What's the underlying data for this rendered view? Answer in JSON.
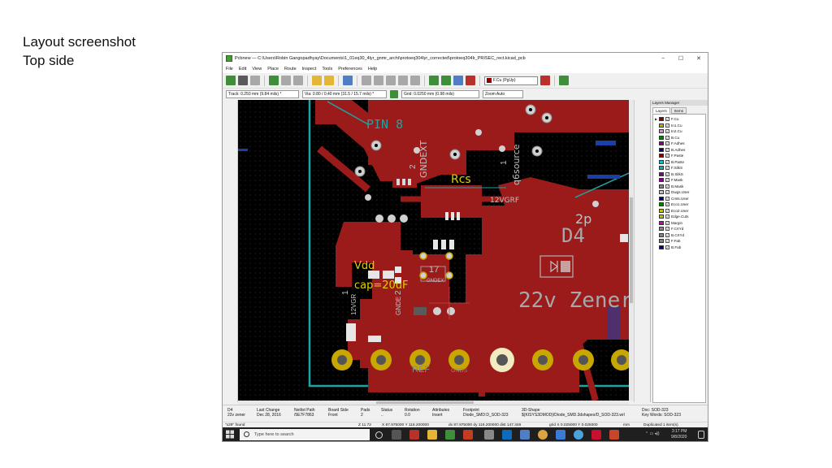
{
  "slide": {
    "line1": "Layout screenshot",
    "line2": "Top side"
  },
  "window": {
    "title": "Pcbnew — C:\\Users\\Robin Gangopadhyay\\Documents\\1_01eq30_4lyr_gnmr_archi\\protoeq304lyr_corrected\\protoeq304lr_PRISEC_rect.kicad_pcb",
    "minimize": "−",
    "maximize": "☐",
    "close": "✕"
  },
  "menu": [
    "File",
    "Edit",
    "View",
    "Place",
    "Route",
    "Inspect",
    "Tools",
    "Preferences",
    "Help"
  ],
  "toolbar": {
    "layer_select": "F.Cu (PgUp)"
  },
  "toolbar2": {
    "track": "Track: 0.250 mm (9.84 mils) *",
    "via": "Via: 0.80 / 0.40 mm (31.5 / 15.7 mils) *",
    "grid": "Grid: 0.0250 mm (0.98 mils)",
    "zoom": "Zoom Auto"
  },
  "canvas_labels": {
    "pin8": "PIN 8",
    "gndext": "GNDEXT",
    "pad2": "2",
    "pad1": "1",
    "q6source": "q6source",
    "rcs": "Rcs",
    "net12vgrf": "12VGRF",
    "d4": "D4",
    "zener": "22v Zener",
    "vdd": "Vdd",
    "cap": "cap=20uF",
    "net12vgr": "12VGR",
    "gnde": "GNDE",
    "pad17": "17",
    "gndex": "GNDEX",
    "ref": "REF",
    "gnds": "GNDS",
    "pad1b": "1",
    "pad2b": "2",
    "partial": "2p"
  },
  "layers_manager": {
    "title": "Layers Manager",
    "tabs": [
      "Layers",
      "Items"
    ],
    "layers": [
      {
        "name": "F.Cu",
        "color": "#8b0000",
        "active": true
      },
      {
        "name": "In1.Cu",
        "color": "#b5b000"
      },
      {
        "name": "In2.Cu",
        "color": "#c0a0c0"
      },
      {
        "name": "B.Cu",
        "color": "#008000"
      },
      {
        "name": "F.Adhes",
        "color": "#840084"
      },
      {
        "name": "B.Adhes",
        "color": "#000084"
      },
      {
        "name": "F.Paste",
        "color": "#840000"
      },
      {
        "name": "B.Paste",
        "color": "#00c2c2"
      },
      {
        "name": "F.SilkS",
        "color": "#00b4b4"
      },
      {
        "name": "B.SilkS",
        "color": "#840084"
      },
      {
        "name": "F.Mask",
        "color": "#840084"
      },
      {
        "name": "B.Mask",
        "color": "#848484"
      },
      {
        "name": "Dwgs.User",
        "color": "#c2c2c2"
      },
      {
        "name": "Cmts.User",
        "color": "#000084"
      },
      {
        "name": "Eco1.User",
        "color": "#008400"
      },
      {
        "name": "Eco2.User",
        "color": "#c2c200"
      },
      {
        "name": "Edge.Cuts",
        "color": "#c2c200"
      },
      {
        "name": "Margin",
        "color": "#c200c2"
      },
      {
        "name": "F.CrtYd",
        "color": "#848484"
      },
      {
        "name": "B.CrtYd",
        "color": "#848484"
      },
      {
        "name": "F.Fab",
        "color": "#848484"
      },
      {
        "name": "B.Fab",
        "color": "#000084"
      }
    ]
  },
  "status": {
    "ref": "D4",
    "value": "22v zener",
    "last_change_h": "Last Change",
    "last_change": "Dec 28, 2016",
    "netlist_h": "Netlist Path",
    "netlist": "/5E7F7863",
    "side_h": "Board Side",
    "side": "Front",
    "pads_h": "Pads",
    "pads": "2",
    "status_h": "Status",
    "status": "..",
    "rotation_h": "Rotation",
    "rotation": "0.0",
    "attributes_h": "Attributes",
    "attributes": "Insert",
    "footprint_h": "Footprint",
    "footprint": "Diode_SMD:D_SOD-323",
    "shape3d_h": "3D-Shape",
    "shape3d": "${KISYS3DMOD}/Diode_SMD.3dshapes/D_SOD-323.wrl",
    "doc": "Doc: SOD-323",
    "keywords": "Key Words: SOD-323",
    "z": "Z 11.72",
    "xy": "X 87.975000  Y 118.200000",
    "dxdy": "dx 87.975000  dy 118.200000  dist 147.346",
    "grid": "grid X 0.025000  Y 0.025000",
    "unit": "mm",
    "msg": "Duplicated 1 item(s)",
    "x29": "\"x29\" found"
  },
  "taskbar": {
    "search_placeholder": "Type here to search",
    "time": "3:17 PM",
    "date": "9/8/2020"
  }
}
